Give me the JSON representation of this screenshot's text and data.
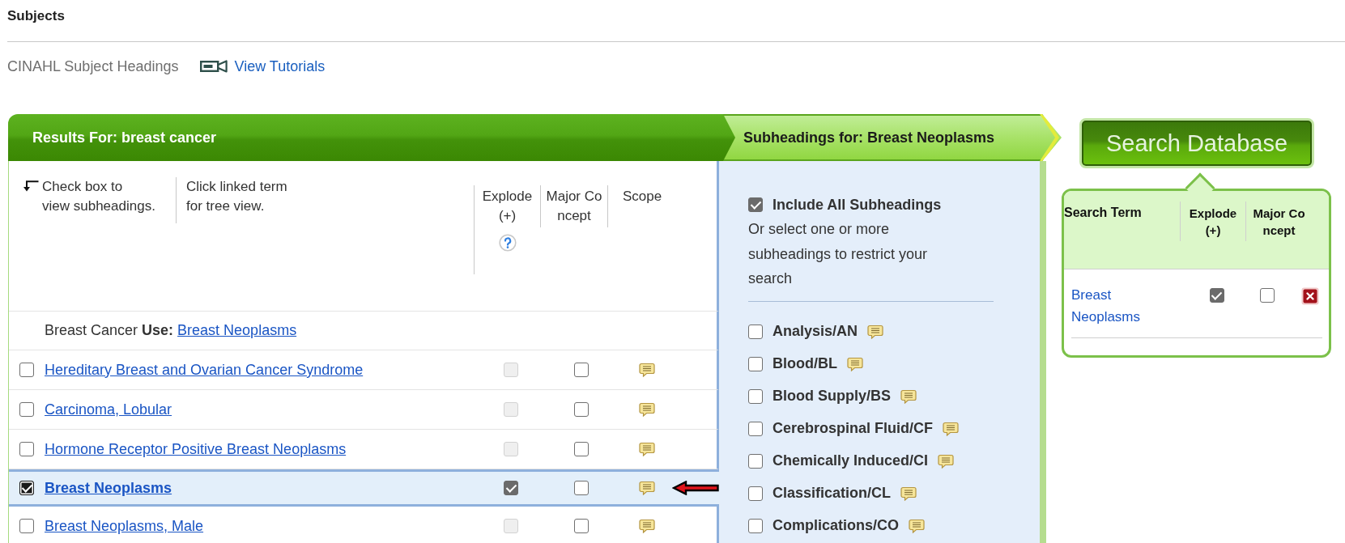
{
  "page": {
    "title": "Subjects"
  },
  "header": {
    "vocabulary": "CINAHL Subject Headings",
    "tutorials_link": "View Tutorials"
  },
  "results": {
    "heading": "Results For: breast cancer",
    "instructions": [
      "Check box to\nview subheadings.",
      "Click linked term for tree view."
    ],
    "columns": [
      "Explode (+)",
      "Major Concept",
      "Scope"
    ],
    "use_reference": {
      "text": "Breast Cancer **Use:**",
      "term": "Breast Neoplasms"
    },
    "rows": [
      {
        "term": "Hereditary Breast and Ovarian Cancer Syndrome",
        "checked": false,
        "selected": false,
        "explode": {
          "checked": false,
          "disabled": true
        },
        "major_concept": {
          "checked": false
        }
      },
      {
        "term": "Carcinoma, Lobular",
        "checked": false,
        "selected": false,
        "explode": {
          "checked": false,
          "disabled": true
        },
        "major_concept": {
          "checked": false
        }
      },
      {
        "term": "Hormone Receptor Positive Breast Neoplasms",
        "checked": false,
        "selected": false,
        "explode": {
          "checked": false,
          "disabled": true
        },
        "major_concept": {
          "checked": false
        }
      },
      {
        "term": "Breast Neoplasms",
        "checked": true,
        "selected": true,
        "explode": {
          "checked": true,
          "disabled": false
        },
        "major_concept": {
          "checked": false
        }
      },
      {
        "term": "Breast Neoplasms, Male",
        "checked": false,
        "selected": false,
        "explode": {
          "checked": false,
          "disabled": true
        },
        "major_concept": {
          "checked": false
        }
      }
    ]
  },
  "subheadings": {
    "heading": "Subheadings for: Breast Neoplasms",
    "include_all": {
      "label": "Include All Subheadings",
      "checked": true
    },
    "hint": "Or select one or more subheadings to restrict your search",
    "items": [
      {
        "label": "Analysis/AN",
        "checked": false
      },
      {
        "label": "Blood/BL",
        "checked": false
      },
      {
        "label": "Blood Supply/BS",
        "checked": false
      },
      {
        "label": "Cerebrospinal Fluid/CF",
        "checked": false
      },
      {
        "label": "Chemically Induced/CI",
        "checked": false
      },
      {
        "label": "Classification/CL",
        "checked": false
      },
      {
        "label": "Complications/CO",
        "checked": false
      }
    ]
  },
  "search_builder": {
    "button": "Search Database",
    "columns": [
      "Search Term",
      "Explode (+)",
      "Major Concept"
    ],
    "terms": [
      {
        "term": "Breast Neoplasms",
        "explode": {
          "checked": true
        },
        "major_concept": {
          "checked": false
        }
      }
    ]
  }
}
